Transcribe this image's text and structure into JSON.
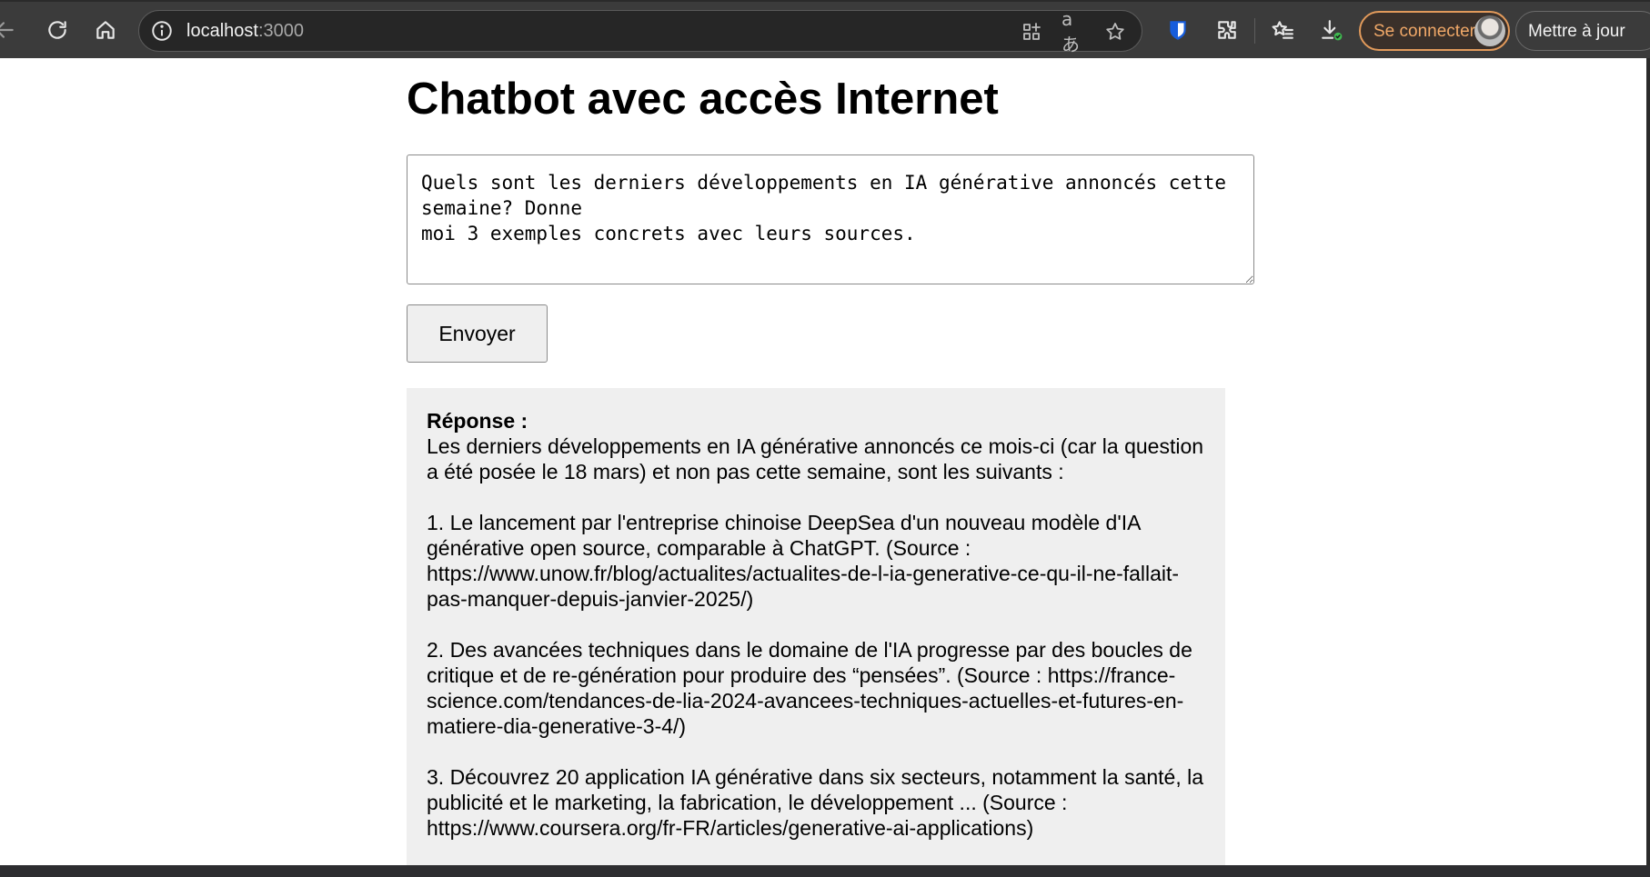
{
  "browser": {
    "address": {
      "host": "localhost",
      "port": ":3000"
    },
    "connect_label": "Se connecter",
    "update_label": "Mettre à jour",
    "translate_glyph": "aあ"
  },
  "page": {
    "title": "Chatbot avec accès Internet",
    "question_value": "Quels sont les derniers développements en IA générative annoncés cette semaine? Donne\nmoi 3 exemples concrets avec leurs sources.",
    "send_label": "Envoyer",
    "response": {
      "heading": "Réponse :",
      "intro": "Les derniers développements en IA générative annoncés ce mois-ci (car la question a été posée le 18 mars) et non pas cette semaine, sont les suivants :",
      "items": [
        "1. Le lancement par l'entreprise chinoise DeepSea d'un nouveau modèle d'IA générative open source, comparable à ChatGPT. (Source : https://www.unow.fr/blog/actualites/actualites-de-l-ia-generative-ce-qu-il-ne-fallait-pas-manquer-depuis-janvier-2025/)",
        "2. Des avancées techniques dans le domaine de l'IA progresse par des boucles de critique et de re-génération pour produire des “pensées”. (Source : https://france-science.com/tendances-de-lia-2024-avancees-techniques-actuelles-et-futures-en-matiere-dia-generative-3-4/)",
        "3. Découvrez 20 application IA générative dans six secteurs, notamment la santé, la publicité et le marketing, la fabrication, le développement ... (Source : https://www.coursera.org/fr-FR/articles/generative-ai-applications)"
      ]
    }
  }
}
